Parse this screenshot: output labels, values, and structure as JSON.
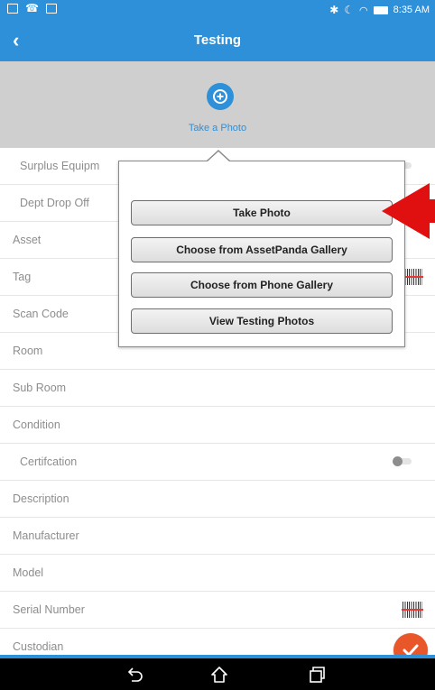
{
  "status_bar": {
    "time": "8:35 AM"
  },
  "app_bar": {
    "title": "Testing",
    "back_icon": "back-arrow-icon"
  },
  "photo": {
    "label": "Take a Photo",
    "icon": "add-photo-icon"
  },
  "form": {
    "rows": [
      {
        "label": "Surplus Equipm",
        "control": "toggle"
      },
      {
        "label": "Dept Drop Off",
        "control": "toggle"
      },
      {
        "label": "Asset",
        "control": "none"
      },
      {
        "label": "Tag",
        "control": "barcode"
      },
      {
        "label": "Scan Code",
        "control": "none"
      },
      {
        "label": "Room",
        "control": "none"
      },
      {
        "label": "Sub Room",
        "control": "none"
      },
      {
        "label": "Condition",
        "control": "none"
      },
      {
        "label": "Certifcation",
        "control": "toggle"
      },
      {
        "label": "Description",
        "control": "none"
      },
      {
        "label": "Manufacturer",
        "control": "none"
      },
      {
        "label": "Model",
        "control": "none"
      },
      {
        "label": "Serial Number",
        "control": "barcode"
      },
      {
        "label": "Custodian",
        "control": "none"
      }
    ]
  },
  "popup": {
    "options": [
      "Take Photo",
      "Choose from AssetPanda Gallery",
      "Choose from Phone Gallery",
      "View Testing Photos"
    ]
  },
  "colors": {
    "accent": "#2d90d9",
    "fab": "#e8562a",
    "annotation": "#e01010"
  }
}
